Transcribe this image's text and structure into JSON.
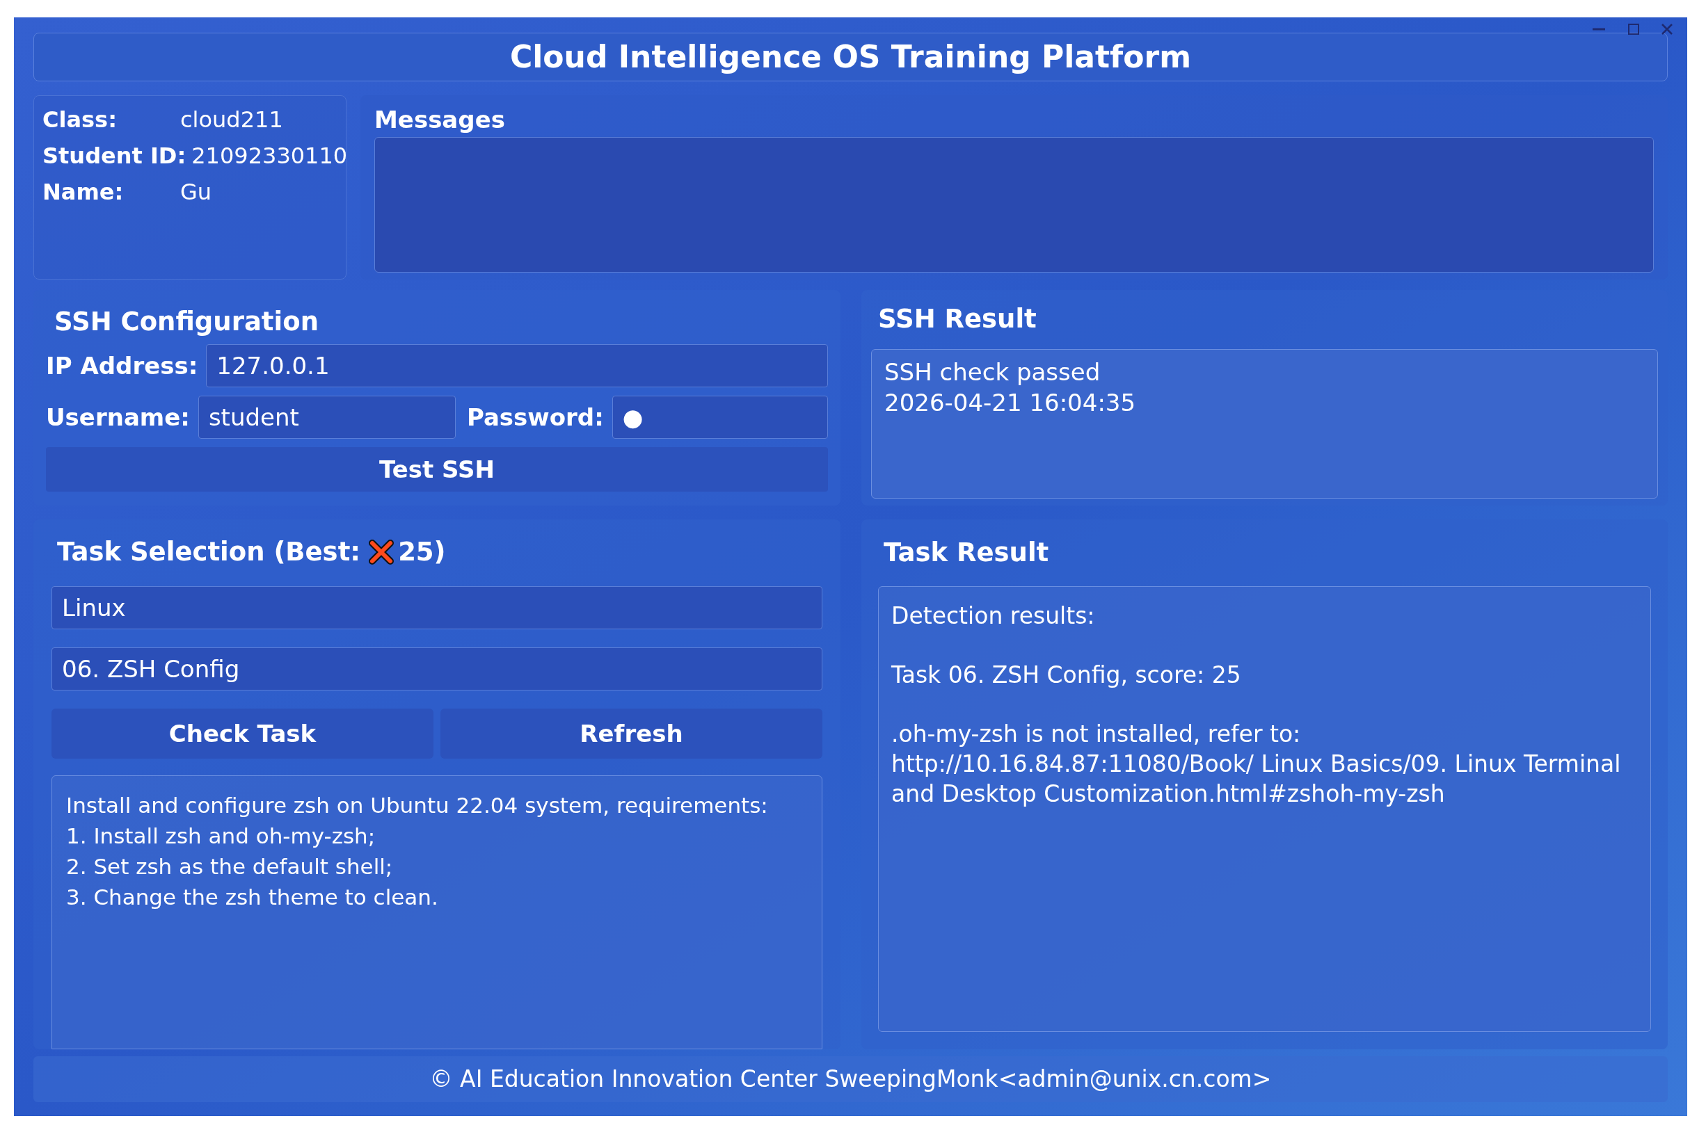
{
  "window": {
    "title": "Cloud Intelligence OS Training Platform"
  },
  "student": [
    {
      "label": "Class:",
      "value": "cloud211"
    },
    {
      "label": "Student ID:",
      "value": "21092330110"
    },
    {
      "label": "Name:",
      "value": "Gu"
    }
  ],
  "messages": {
    "heading": "Messages"
  },
  "ssh_config": {
    "heading": "SSH Configuration",
    "ip_label": "IP Address:",
    "ip": "127.0.0.1",
    "username_label": "Username:",
    "username": "student",
    "password_label": "Password:",
    "password": "●",
    "button": "Test SSH"
  },
  "ssh_result": {
    "heading": "SSH Result",
    "lines": [
      "SSH check passed",
      "2026-04-21 16:04:35"
    ]
  },
  "task_selection": {
    "heading_start": "Task Selection (Best:",
    "best_passed": false,
    "best_score": "25)",
    "category": "Linux",
    "task": "06. ZSH Config",
    "buttons": [
      "Check Task",
      "Refresh"
    ],
    "description": [
      "Install and configure zsh on Ubuntu 22.04 system, requirements:",
      "1. Install zsh and oh-my-zsh;",
      "2. Set zsh as the default shell;",
      "3. Change the zsh theme to clean."
    ]
  },
  "task_result": {
    "heading": "Task Result",
    "paragraphs": [
      "Detection results:",
      "Task 06. ZSH Config, score: 25",
      ".oh-my-zsh is not installed, refer to: http://10.16.84.87:11080/Book/ Linux Basics/09. Linux Terminal and Desktop Customization.html#zshoh-my-zsh"
    ]
  },
  "footer": "© AI Education Innovation Center SweepingMonk<admin@unix.cn.com>"
}
